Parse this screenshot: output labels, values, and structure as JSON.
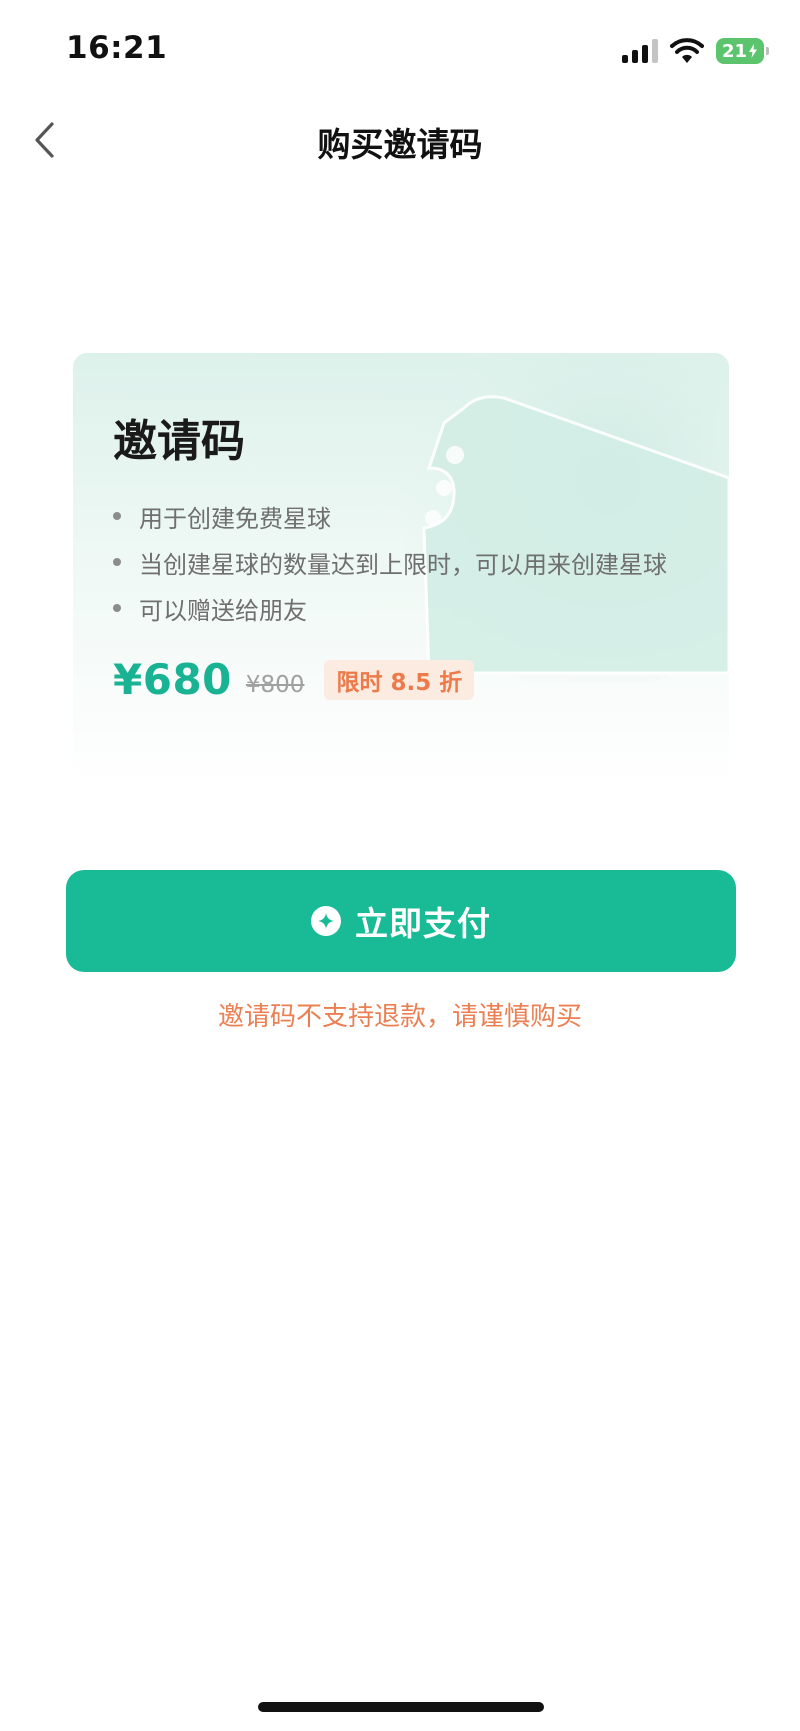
{
  "status_bar": {
    "time": "16:21",
    "battery_level": "21",
    "icons": [
      "signal-icon",
      "wifi-icon",
      "battery-charging-icon"
    ]
  },
  "nav": {
    "back_icon": "chevron-left-icon",
    "title": "购买邀请码"
  },
  "card": {
    "title": "邀请码",
    "features": [
      "用于创建免费星球",
      "当创建星球的数量达到上限时，可以用来创建星球",
      "可以赠送给朋友"
    ],
    "price": "¥680",
    "original_price": "¥800",
    "discount_badge": "限时 8.5 折"
  },
  "pay_button": {
    "label": "立即支付",
    "icon": "sparkle-circle-icon"
  },
  "refund_note": "邀请码不支持退款，请谨慎购买",
  "colors": {
    "accent": "#19bb97",
    "price": "#19b394",
    "warning": "#ec7f52",
    "badge_bg": "#fcebe0"
  }
}
